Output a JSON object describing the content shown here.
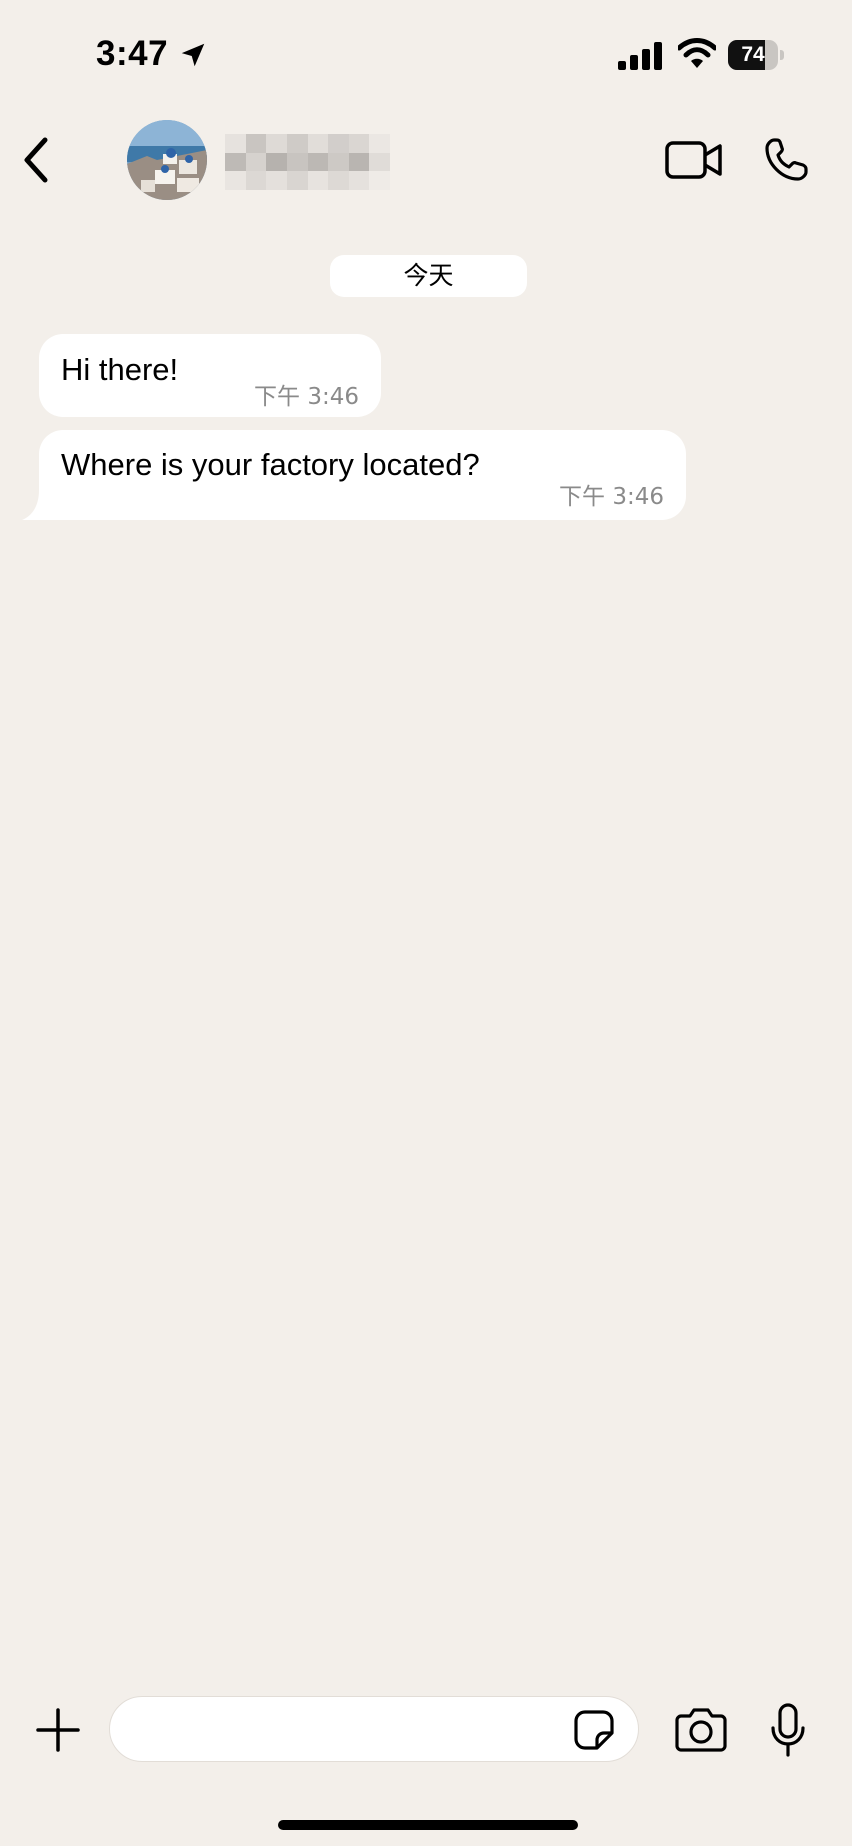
{
  "status_bar": {
    "time": "3:47",
    "battery_level": "74",
    "battery_fraction": 0.74,
    "icons": [
      "location-arrow-icon",
      "cellular-signal-icon",
      "wifi-icon",
      "battery-icon"
    ]
  },
  "header": {
    "back_icon": "chevron-left-icon",
    "avatar_description": "avatar photo",
    "contact_name_redacted": true,
    "video_icon": "video-camera-icon",
    "voice_icon": "phone-icon"
  },
  "chat": {
    "date_separator": "今天",
    "messages": [
      {
        "text": "Hi there!",
        "time": "下午 3:46",
        "direction": "incoming"
      },
      {
        "text": "Where is your factory located?",
        "time": "下午 3:46",
        "direction": "incoming"
      }
    ]
  },
  "composer": {
    "add_icon": "plus-icon",
    "input_value": "",
    "input_placeholder": "",
    "sticker_icon": "sticker-icon",
    "camera_icon": "camera-icon",
    "mic_icon": "microphone-icon"
  },
  "colors": {
    "background": "#f3efea",
    "bubble": "#ffffff",
    "timestamp": "#8a8a8a"
  }
}
